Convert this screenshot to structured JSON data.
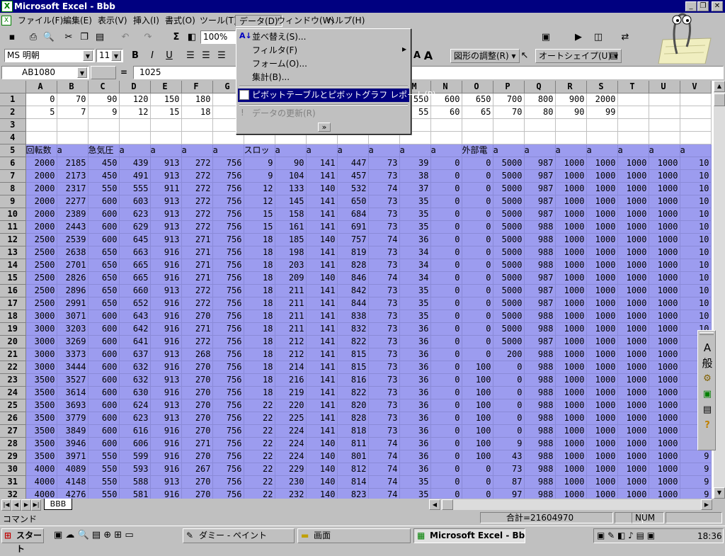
{
  "window": {
    "title": "Microsoft Excel - Bbb",
    "icon_label": "X"
  },
  "menu": [
    "ファイル(F)",
    "編集(E)",
    "表示(V)",
    "挿入(I)",
    "書式(O)",
    "ツール(T)",
    "データ(D)",
    "ウィンドウ(W)",
    "ヘルプ(H)"
  ],
  "toolbar": {
    "zoom": "100%",
    "font_name": "MS 明朝",
    "font_size": "11",
    "bold": "B",
    "italic": "I",
    "underline": "U",
    "sum": "Σ",
    "shape_adjust": "図形の調整(R)",
    "autoshape": "オートシェイプ(U)"
  },
  "formula": {
    "name_box": "AB1080",
    "equals": "=",
    "value": "1025"
  },
  "data_menu": {
    "items": [
      "並べ替え(S)...",
      "フィルタ(F)",
      "フォーム(O)...",
      "集計(B)...",
      "ピボットテーブルとピボットグラフ レポート(P)...",
      "データの更新(R)"
    ],
    "highlighted": 4,
    "disabled": 5,
    "more": "»"
  },
  "grid": {
    "columns": [
      "A",
      "B",
      "C",
      "D",
      "E",
      "F",
      "G",
      "H",
      "I",
      "J",
      "K",
      "L",
      "M",
      "N",
      "O",
      "P",
      "Q",
      "R",
      "S",
      "T",
      "U",
      "V"
    ],
    "rows": [
      [
        "0",
        "70",
        "90",
        "120",
        "150",
        "180",
        "2",
        "",
        "",
        "",
        "",
        "",
        "550",
        "600",
        "650",
        "700",
        "800",
        "900",
        "2000",
        "",
        "",
        ""
      ],
      [
        "5",
        "7",
        "9",
        "12",
        "15",
        "18",
        "",
        "",
        "",
        "",
        "",
        "",
        "55",
        "60",
        "65",
        "70",
        "80",
        "90",
        "99",
        "",
        "",
        ""
      ],
      [
        "",
        "",
        "",
        "",
        "",
        "",
        "",
        "",
        "",
        "",
        "",
        "",
        "",
        "",
        "",
        "",
        "",
        "",
        "",
        "",
        "",
        ""
      ],
      [
        "",
        "",
        "",
        "",
        "",
        "",
        "",
        "",
        "",
        "",
        "",
        "",
        "",
        "",
        "",
        "",
        "",
        "",
        "",
        "",
        "",
        ""
      ],
      [
        "回転数",
        "a",
        "急気圧",
        "a",
        "a",
        "a",
        "a",
        "スロッ",
        "a",
        "a",
        "a",
        "a",
        "a",
        "a",
        "外部電",
        "a",
        "a",
        "a",
        "a",
        "a",
        "a",
        "a"
      ],
      [
        "2000",
        "2185",
        "450",
        "439",
        "913",
        "272",
        "756",
        "9",
        "90",
        "141",
        "447",
        "73",
        "39",
        "0",
        "0",
        "5000",
        "987",
        "1000",
        "1000",
        "1000",
        "1000",
        "10"
      ],
      [
        "2000",
        "2173",
        "450",
        "491",
        "913",
        "272",
        "756",
        "9",
        "104",
        "141",
        "457",
        "73",
        "38",
        "0",
        "0",
        "5000",
        "987",
        "1000",
        "1000",
        "1000",
        "1000",
        "10"
      ],
      [
        "2000",
        "2317",
        "550",
        "555",
        "911",
        "272",
        "756",
        "12",
        "133",
        "140",
        "532",
        "74",
        "37",
        "0",
        "0",
        "5000",
        "987",
        "1000",
        "1000",
        "1000",
        "1000",
        "10"
      ],
      [
        "2000",
        "2277",
        "600",
        "603",
        "913",
        "272",
        "756",
        "12",
        "145",
        "141",
        "650",
        "73",
        "35",
        "0",
        "0",
        "5000",
        "987",
        "1000",
        "1000",
        "1000",
        "1000",
        "10"
      ],
      [
        "2000",
        "2389",
        "600",
        "623",
        "913",
        "272",
        "756",
        "15",
        "158",
        "141",
        "684",
        "73",
        "35",
        "0",
        "0",
        "5000",
        "987",
        "1000",
        "1000",
        "1000",
        "1000",
        "10"
      ],
      [
        "2000",
        "2443",
        "600",
        "629",
        "913",
        "272",
        "756",
        "15",
        "161",
        "141",
        "691",
        "73",
        "35",
        "0",
        "0",
        "5000",
        "988",
        "1000",
        "1000",
        "1000",
        "1000",
        "10"
      ],
      [
        "2500",
        "2539",
        "600",
        "645",
        "913",
        "271",
        "756",
        "18",
        "185",
        "140",
        "757",
        "74",
        "36",
        "0",
        "0",
        "5000",
        "988",
        "1000",
        "1000",
        "1000",
        "1000",
        "10"
      ],
      [
        "2500",
        "2638",
        "650",
        "663",
        "916",
        "271",
        "756",
        "18",
        "198",
        "141",
        "819",
        "73",
        "34",
        "0",
        "0",
        "5000",
        "988",
        "1000",
        "1000",
        "1000",
        "1000",
        "10"
      ],
      [
        "2500",
        "2701",
        "650",
        "665",
        "916",
        "271",
        "756",
        "18",
        "203",
        "141",
        "828",
        "73",
        "34",
        "0",
        "0",
        "5000",
        "988",
        "1000",
        "1000",
        "1000",
        "1000",
        "10"
      ],
      [
        "2500",
        "2826",
        "650",
        "665",
        "916",
        "271",
        "756",
        "18",
        "209",
        "140",
        "846",
        "74",
        "34",
        "0",
        "0",
        "5000",
        "987",
        "1000",
        "1000",
        "1000",
        "1000",
        "10"
      ],
      [
        "2500",
        "2896",
        "650",
        "660",
        "913",
        "272",
        "756",
        "18",
        "211",
        "141",
        "842",
        "73",
        "35",
        "0",
        "0",
        "5000",
        "987",
        "1000",
        "1000",
        "1000",
        "1000",
        "10"
      ],
      [
        "2500",
        "2991",
        "650",
        "652",
        "916",
        "272",
        "756",
        "18",
        "211",
        "141",
        "844",
        "73",
        "35",
        "0",
        "0",
        "5000",
        "987",
        "1000",
        "1000",
        "1000",
        "1000",
        "10"
      ],
      [
        "3000",
        "3071",
        "600",
        "643",
        "916",
        "270",
        "756",
        "18",
        "211",
        "141",
        "838",
        "73",
        "35",
        "0",
        "0",
        "5000",
        "988",
        "1000",
        "1000",
        "1000",
        "1000",
        "10"
      ],
      [
        "3000",
        "3203",
        "600",
        "642",
        "916",
        "271",
        "756",
        "18",
        "211",
        "141",
        "832",
        "73",
        "36",
        "0",
        "0",
        "5000",
        "988",
        "1000",
        "1000",
        "1000",
        "1000",
        "10"
      ],
      [
        "3000",
        "3269",
        "600",
        "641",
        "916",
        "272",
        "756",
        "18",
        "212",
        "141",
        "822",
        "73",
        "36",
        "0",
        "0",
        "5000",
        "987",
        "1000",
        "1000",
        "1000",
        "1000",
        "10"
      ],
      [
        "3000",
        "3373",
        "600",
        "637",
        "913",
        "268",
        "756",
        "18",
        "212",
        "141",
        "815",
        "73",
        "36",
        "0",
        "0",
        "200",
        "988",
        "1000",
        "1000",
        "1000",
        "1000",
        "10"
      ],
      [
        "3000",
        "3444",
        "600",
        "632",
        "916",
        "270",
        "756",
        "18",
        "214",
        "141",
        "815",
        "73",
        "36",
        "0",
        "100",
        "0",
        "988",
        "1000",
        "1000",
        "1000",
        "1000",
        "10"
      ],
      [
        "3500",
        "3527",
        "600",
        "632",
        "913",
        "270",
        "756",
        "18",
        "216",
        "141",
        "816",
        "73",
        "36",
        "0",
        "100",
        "0",
        "988",
        "1000",
        "1000",
        "1000",
        "1000",
        "10"
      ],
      [
        "3500",
        "3614",
        "600",
        "630",
        "916",
        "270",
        "756",
        "18",
        "219",
        "141",
        "822",
        "73",
        "36",
        "0",
        "100",
        "0",
        "988",
        "1000",
        "1000",
        "1000",
        "1000",
        "10"
      ],
      [
        "3500",
        "3693",
        "600",
        "624",
        "913",
        "270",
        "756",
        "22",
        "220",
        "141",
        "820",
        "73",
        "36",
        "0",
        "100",
        "0",
        "988",
        "1000",
        "1000",
        "1000",
        "1000",
        "10"
      ],
      [
        "3500",
        "3779",
        "600",
        "623",
        "913",
        "270",
        "756",
        "22",
        "225",
        "141",
        "828",
        "73",
        "36",
        "0",
        "100",
        "0",
        "988",
        "1000",
        "1000",
        "1000",
        "1000",
        "10"
      ],
      [
        "3500",
        "3849",
        "600",
        "616",
        "916",
        "270",
        "756",
        "22",
        "224",
        "141",
        "818",
        "73",
        "36",
        "0",
        "100",
        "0",
        "988",
        "1000",
        "1000",
        "1000",
        "1000",
        "10"
      ],
      [
        "3500",
        "3946",
        "600",
        "606",
        "916",
        "271",
        "756",
        "22",
        "224",
        "140",
        "811",
        "74",
        "36",
        "0",
        "100",
        "9",
        "988",
        "1000",
        "1000",
        "1000",
        "1000",
        "10"
      ],
      [
        "3500",
        "3971",
        "550",
        "599",
        "916",
        "270",
        "756",
        "22",
        "224",
        "140",
        "801",
        "74",
        "36",
        "0",
        "100",
        "43",
        "988",
        "1000",
        "1000",
        "1000",
        "1000",
        "9"
      ],
      [
        "4000",
        "4089",
        "550",
        "593",
        "916",
        "267",
        "756",
        "22",
        "229",
        "140",
        "812",
        "74",
        "36",
        "0",
        "0",
        "73",
        "988",
        "1000",
        "1000",
        "1000",
        "1000",
        "9"
      ],
      [
        "4000",
        "4148",
        "550",
        "588",
        "913",
        "270",
        "756",
        "22",
        "230",
        "140",
        "814",
        "74",
        "35",
        "0",
        "0",
        "87",
        "988",
        "1000",
        "1000",
        "1000",
        "1000",
        "9"
      ],
      [
        "4000",
        "4276",
        "550",
        "581",
        "916",
        "270",
        "756",
        "22",
        "232",
        "140",
        "823",
        "74",
        "35",
        "0",
        "0",
        "97",
        "988",
        "1000",
        "1000",
        "1000",
        "1000",
        "9"
      ]
    ]
  },
  "sheet_tab": "BBB",
  "status": {
    "mode": "コマンド",
    "sum": "合計=21604970",
    "num": "NUM"
  },
  "taskbar": {
    "start": "スタート",
    "tasks": [
      "ダミー - ペイント",
      "画面",
      "Microsoft Excel - Bbb"
    ],
    "clock": "18:36"
  },
  "format_palette": [
    "A",
    "般"
  ],
  "colors": {
    "selection": "#9c9cef",
    "title": "#000080",
    "face": "#c0c0c0"
  }
}
